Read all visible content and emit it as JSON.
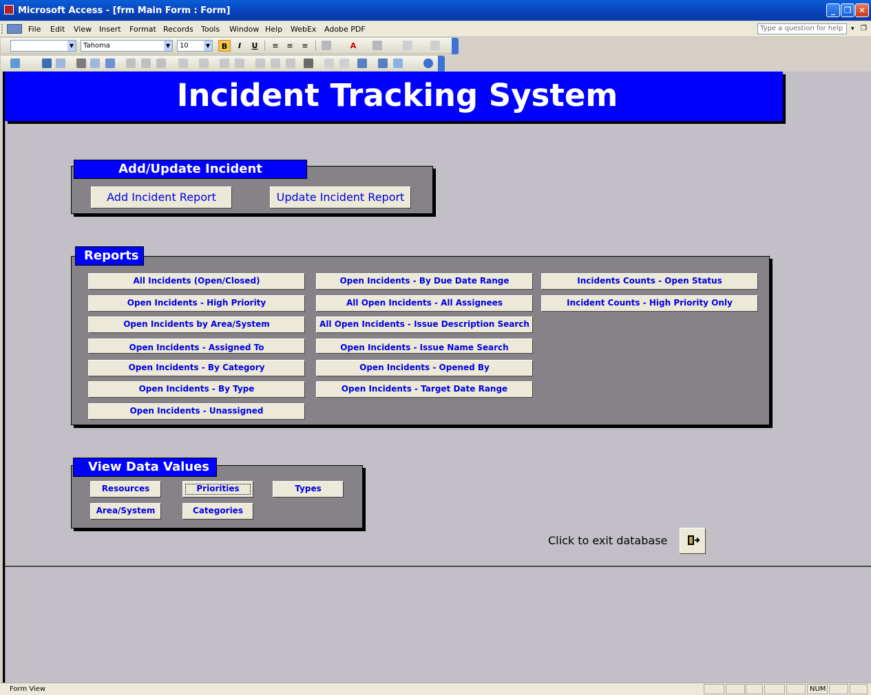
{
  "window": {
    "title": "Microsoft Access - [frm Main Form : Form]",
    "controls": [
      "minimize",
      "restore",
      "close"
    ]
  },
  "menubar": {
    "items": [
      "File",
      "Edit",
      "View",
      "Insert",
      "Format",
      "Records",
      "Tools",
      "Window",
      "Help",
      "WebEx",
      "Adobe PDF"
    ],
    "help_placeholder": "Type a question for help"
  },
  "format_toolbar": {
    "object_combo": "",
    "font_name": "Tahoma",
    "font_size": "10",
    "bold_label": "B",
    "italic_label": "I",
    "underline_label": "U"
  },
  "form": {
    "header_title": "Incident Tracking System",
    "add_update": {
      "title": "Add/Update Incident",
      "buttons": [
        "Add Incident Report",
        "Update Incident Report"
      ]
    },
    "reports": {
      "title": "Reports",
      "col1": [
        "All Incidents (Open/Closed)",
        "Open Incidents - High Priority",
        "Open Incidents by Area/System",
        "Open Incidents - Assigned To",
        "Open Incidents - By Category",
        "Open Incidents - By Type",
        "Open Incidents - Unassigned"
      ],
      "col2": [
        "Open Incidents - By Due Date Range",
        "All Open Incidents - All Assignees",
        "All Open Incidents - Issue Description Search",
        "Open Incidents -  Issue Name Search",
        "Open Incidents - Opened By",
        "Open Incidents - Target Date Range"
      ],
      "col3": [
        "Incidents Counts - Open Status",
        "Incident Counts -  High Priority Only"
      ]
    },
    "view_data": {
      "title": "View Data Values",
      "buttons": [
        "Resources",
        "Priorities",
        "Types",
        "Area/System",
        "Categories"
      ]
    },
    "exit_label": "Click to exit database"
  },
  "statusbar": {
    "mode": "Form View",
    "num": "NUM"
  },
  "colors": {
    "header_blue": "#0000ff",
    "panel_gray": "#858387",
    "form_bg": "#c2c0c6",
    "button_text": "#0000e0"
  }
}
